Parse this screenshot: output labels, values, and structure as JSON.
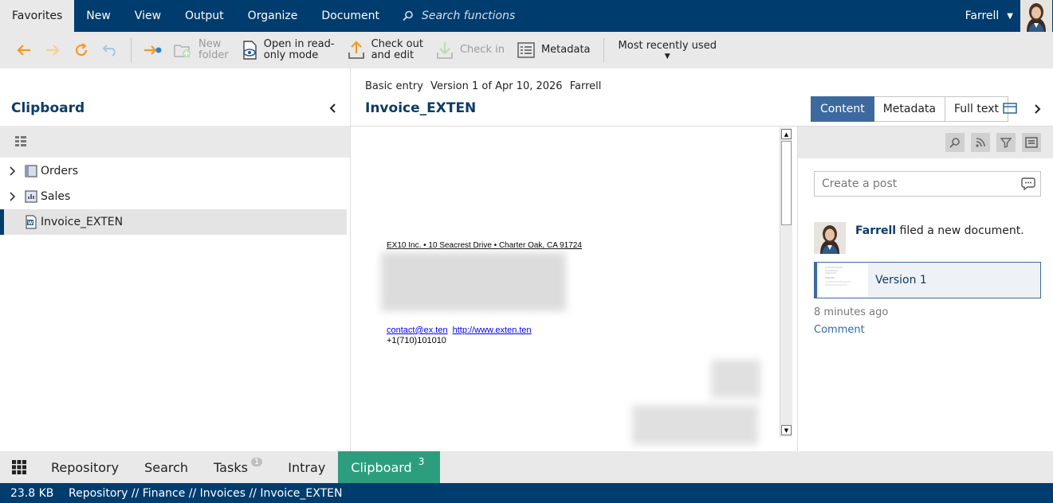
{
  "menubar": {
    "tabs": [
      "Favorites",
      "New",
      "View",
      "Output",
      "Organize",
      "Document"
    ],
    "search_placeholder": "Search functions",
    "user": "Farrell"
  },
  "toolbar": {
    "new_folder": [
      "New",
      "folder"
    ],
    "open_readonly": [
      "Open in read-",
      "only mode"
    ],
    "check_out": [
      "Check out",
      "and edit"
    ],
    "check_in": "Check in",
    "metadata": "Metadata",
    "recent": "Most recently used"
  },
  "left": {
    "title": "Clipboard",
    "items": [
      {
        "label": "Orders",
        "icon": "folder-icon"
      },
      {
        "label": "Sales",
        "icon": "register-icon"
      },
      {
        "label": "Invoice_EXTEN",
        "icon": "word-document-icon"
      }
    ]
  },
  "document": {
    "type": "Basic entry",
    "version": "Version 1 of Apr 10, 2026",
    "author": "Farrell",
    "title": "Invoice_EXTEN",
    "tabs": [
      "Content",
      "Metadata",
      "Full text"
    ]
  },
  "preview": {
    "address": "EX10 Inc. • 10 Seacrest Drive • Charter Oak, CA 91724",
    "email": "contact@ex.ten",
    "website": "http://www.exten.ten",
    "phone": "+1(710)101010"
  },
  "feed": {
    "post_placeholder": "Create a post",
    "user": "Farrell",
    "action": "filed a new document.",
    "version_label": "Version 1",
    "time": "8 minutes ago",
    "comment": "Comment"
  },
  "bottomnav": {
    "tabs": [
      {
        "label": "Repository",
        "badge": ""
      },
      {
        "label": "Search",
        "badge": ""
      },
      {
        "label": "Tasks",
        "badge": "1"
      },
      {
        "label": "Intray",
        "badge": ""
      },
      {
        "label": "Clipboard",
        "badge": "3"
      }
    ]
  },
  "status": {
    "size": "23.8 KB",
    "path": "Repository // Finance // Invoices // Invoice_EXTEN"
  },
  "colors": {
    "brand": "#003c6e",
    "accent_tab": "#3d6a9e",
    "clipboard_active": "#2c9e7e"
  }
}
